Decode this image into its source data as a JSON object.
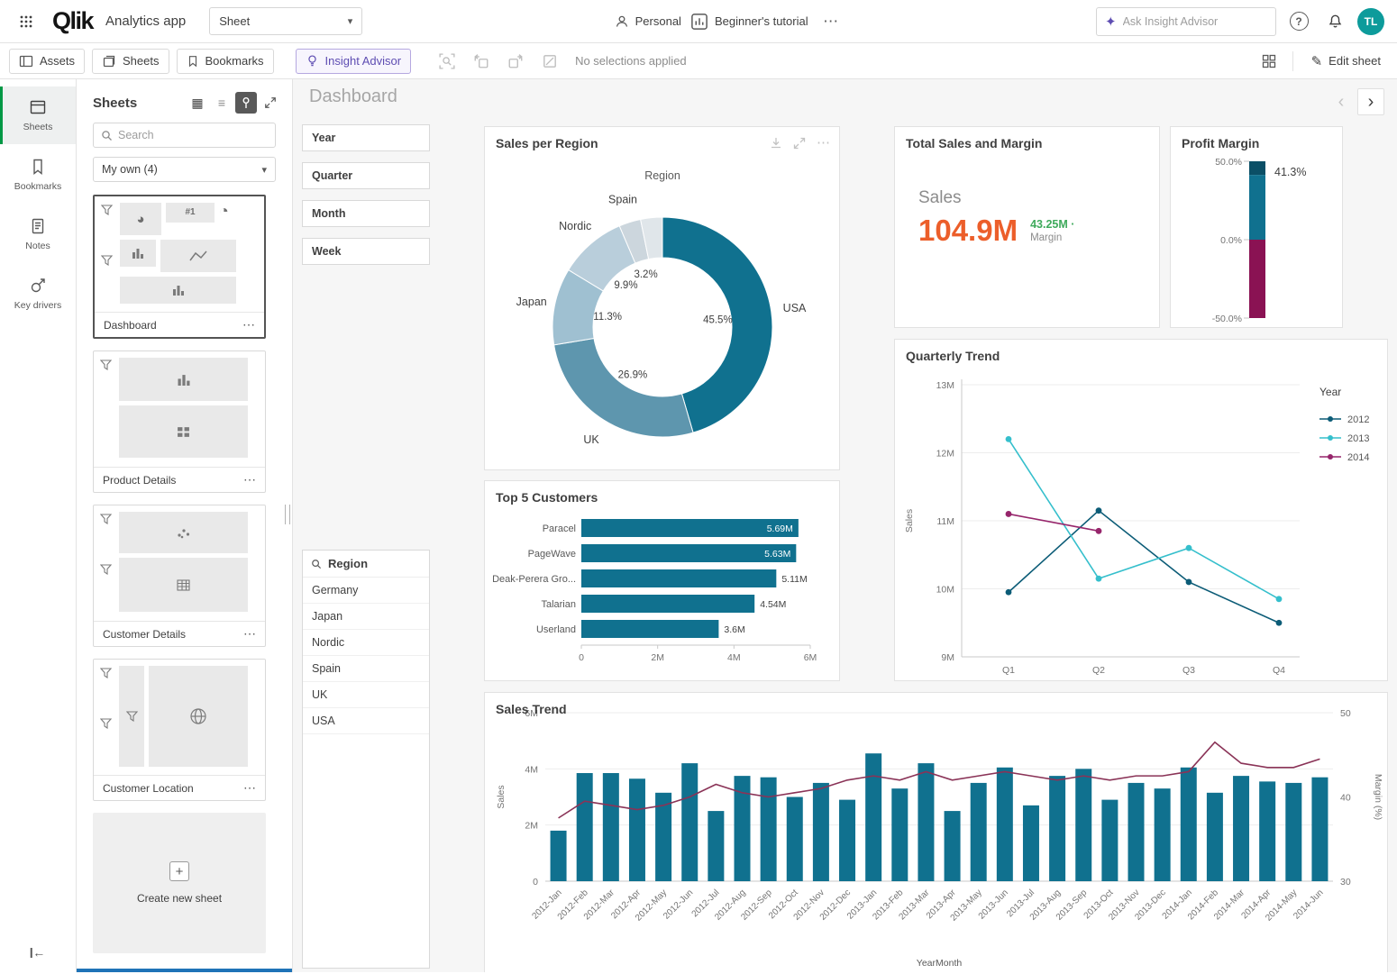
{
  "colors": {
    "teal": "#10718f",
    "teal-dark": "#0b4f66",
    "magenta": "#8a1253",
    "orange": "#ec5e2a",
    "green": "#3faa5c",
    "purple": "#5e4db2",
    "qlik-green": "#009845",
    "avatar": "#0d9b9b",
    "bottom-accent": "#1f73b7"
  },
  "icons": {
    "ellipsis": "⋯",
    "chevron_down": "▾",
    "sparkle": "✦",
    "pencil": "✎",
    "help": "?",
    "plus": "+",
    "grid_view": "▦",
    "list_view": "≡",
    "nav_prev": "‹",
    "nav_next": "›",
    "collapse_left": "←",
    "pie_mini": "◕",
    "gauge_mini": "◔",
    "kpi_mini": "#1"
  },
  "topbar": {
    "logo": "Qlik",
    "app_name": "Analytics app",
    "sheet_selector_label": "Sheet",
    "personal_label": "Personal",
    "tutorial_label": "Beginner's tutorial",
    "insight_placeholder": "Ask Insight Advisor",
    "avatar_initials": "TL"
  },
  "toolbar": {
    "assets_label": "Assets",
    "sheets_label": "Sheets",
    "bookmarks_label": "Bookmarks",
    "insight_advisor_label": "Insight Advisor",
    "selections_status": "No selections applied",
    "edit_sheet_label": "Edit sheet"
  },
  "rail": {
    "items": [
      {
        "label": "Sheets",
        "active": true
      },
      {
        "label": "Bookmarks"
      },
      {
        "label": "Notes"
      },
      {
        "label": "Key drivers"
      }
    ]
  },
  "sheets_panel": {
    "title": "Sheets",
    "search_placeholder": "Search",
    "collection_filter": "My own (4)",
    "sheets": [
      {
        "name": "Dashboard",
        "selected": true
      },
      {
        "name": "Product Details"
      },
      {
        "name": "Customer Details"
      },
      {
        "name": "Customer Location"
      }
    ],
    "create_label": "Create new sheet"
  },
  "sheet": {
    "title": "Dashboard"
  },
  "filters": {
    "items": [
      "Year",
      "Quarter",
      "Month",
      "Week"
    ]
  },
  "region_listbox": {
    "title": "Region",
    "items": [
      "Germany",
      "Japan",
      "Nordic",
      "Spain",
      "UK",
      "USA"
    ]
  },
  "chart_data": [
    {
      "id": "sales-per-region",
      "type": "pie",
      "title": "Sales per Region",
      "legend_title": "Region",
      "labels": [
        "USA",
        "UK",
        "Japan",
        "Nordic",
        "Spain",
        ""
      ],
      "values": [
        45.5,
        26.9,
        11.3,
        9.9,
        3.2,
        3.2
      ],
      "colors": [
        "#10718f",
        "#5e96ae",
        "#9fc0d1",
        "#b9cedb",
        "#ccd6dd",
        "#e0e6ea"
      ]
    },
    {
      "id": "total-sales-margin",
      "type": "kpi",
      "title": "Total Sales and Margin",
      "primary_label": "Sales",
      "primary_value": "104.9M",
      "secondary_value": "43.25M ·",
      "secondary_label": "Margin"
    },
    {
      "id": "profit-margin",
      "type": "gauge",
      "title": "Profit Margin",
      "value": 41.3,
      "value_label": "41.3%",
      "min": -50,
      "max": 50,
      "ticks": [
        {
          "label": "50.0%",
          "value": 50
        },
        {
          "label": "0.0%",
          "value": 0
        },
        {
          "label": "-50.0%",
          "value": -50
        }
      ],
      "positive_color": "#10718f",
      "negative_color": "#8a1253",
      "cap_color": "#0b4f66"
    },
    {
      "id": "quarterly-trend",
      "type": "line",
      "title": "Quarterly Trend",
      "categories": [
        "Q1",
        "Q2",
        "Q3",
        "Q4"
      ],
      "ylabel": "Sales",
      "ylim": [
        9,
        13
      ],
      "yticks": [
        "9M",
        "10M",
        "11M",
        "12M",
        "13M"
      ],
      "legend_title": "Year",
      "legend_position": "right",
      "grid": true,
      "series": [
        {
          "name": "2012",
          "color": "#0c5c77",
          "values": [
            9.95,
            11.15,
            10.1,
            9.5
          ]
        },
        {
          "name": "2013",
          "color": "#35bfcc",
          "values": [
            12.2,
            10.15,
            10.6,
            9.85
          ]
        },
        {
          "name": "2014",
          "color": "#96256b",
          "values": [
            11.1,
            10.85,
            null,
            null
          ]
        }
      ]
    },
    {
      "id": "top-5-customers",
      "type": "bar",
      "orientation": "horizontal",
      "title": "Top 5 Customers",
      "categories": [
        "Paracel",
        "PageWave",
        "Deak-Perera Gro...",
        "Talarian",
        "Userland"
      ],
      "values": [
        5.69,
        5.63,
        5.11,
        4.54,
        3.6
      ],
      "value_labels": [
        "5.69M",
        "5.63M",
        "5.11M",
        "4.54M",
        "3.6M"
      ],
      "labels_inside": [
        true,
        true,
        false,
        false,
        false
      ],
      "xlim": [
        0,
        6
      ],
      "xticks": [
        {
          "label": "0",
          "value": 0
        },
        {
          "label": "2M",
          "value": 2
        },
        {
          "label": "4M",
          "value": 4
        },
        {
          "label": "6M",
          "value": 6
        }
      ],
      "bar_color": "#10718f"
    },
    {
      "id": "sales-trend",
      "type": "bar",
      "subtype": "combo",
      "title": "Sales Trend",
      "xlabel": "YearMonth",
      "ylabel_left": "Sales",
      "ylabel_right": "Margin (%)",
      "ylim_left": [
        0,
        6
      ],
      "yticks_left": [
        {
          "label": "0",
          "value": 0
        },
        {
          "label": "2M",
          "value": 2
        },
        {
          "label": "4M",
          "value": 4
        },
        {
          "label": "6M",
          "value": 6
        }
      ],
      "ylim_right": [
        30,
        50
      ],
      "yticks_right": [
        {
          "label": "30",
          "value": 30
        },
        {
          "label": "40",
          "value": 40
        },
        {
          "label": "50",
          "value": 50
        }
      ],
      "categories": [
        "2012-Jan",
        "2012-Feb",
        "2012-Mar",
        "2012-Apr",
        "2012-May",
        "2012-Jun",
        "2012-Jul",
        "2012-Aug",
        "2012-Sep",
        "2012-Oct",
        "2012-Nov",
        "2012-Dec",
        "2013-Jan",
        "2013-Feb",
        "2013-Mar",
        "2013-Apr",
        "2013-May",
        "2013-Jun",
        "2013-Jul",
        "2013-Aug",
        "2013-Sep",
        "2013-Oct",
        "2013-Nov",
        "2013-Dec",
        "2014-Jan",
        "2014-Feb",
        "2014-Mar",
        "2014-Apr",
        "2014-May",
        "2014-Jun"
      ],
      "bars": {
        "name": "Sales",
        "color": "#10718f",
        "values": [
          1.8,
          3.85,
          3.85,
          3.65,
          3.15,
          4.2,
          2.5,
          3.75,
          3.7,
          3.0,
          3.5,
          2.9,
          4.55,
          3.3,
          4.2,
          2.5,
          3.5,
          4.05,
          2.7,
          3.75,
          4.0,
          2.9,
          3.5,
          3.3,
          4.05,
          3.15,
          3.75,
          3.55,
          3.5,
          3.7
        ]
      },
      "line": {
        "name": "Margin (%)",
        "color": "#8a3357",
        "values": [
          37.5,
          39.5,
          39,
          38.5,
          39,
          40,
          41.5,
          40.5,
          40,
          40.5,
          41,
          42,
          42.5,
          42,
          43,
          42,
          42.5,
          43,
          42.5,
          42,
          42.5,
          42,
          42.5,
          42.5,
          43,
          46.5,
          44,
          43.5,
          43.5,
          44.5
        ]
      }
    }
  ]
}
